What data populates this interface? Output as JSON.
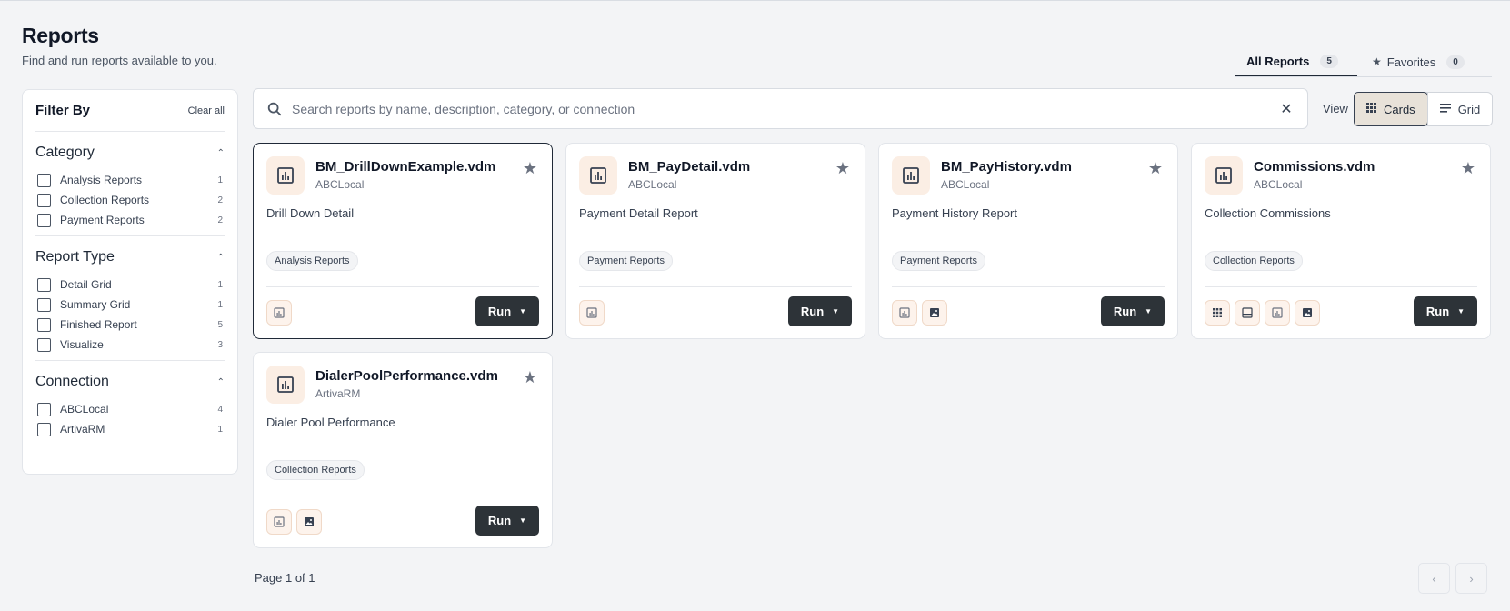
{
  "header": {
    "title": "Reports",
    "subtitle": "Find and run reports available to you."
  },
  "tabs": [
    {
      "label": "All Reports",
      "count": "5",
      "active": true
    },
    {
      "label": "Favorites",
      "count": "0",
      "active": false
    }
  ],
  "sidebar": {
    "title": "Filter By",
    "clear_all": "Clear all",
    "sections": [
      {
        "title": "Category",
        "options": [
          {
            "label": "Analysis Reports",
            "count": "1"
          },
          {
            "label": "Collection Reports",
            "count": "2"
          },
          {
            "label": "Payment Reports",
            "count": "2"
          }
        ]
      },
      {
        "title": "Report Type",
        "options": [
          {
            "label": "Detail Grid",
            "count": "1"
          },
          {
            "label": "Summary Grid",
            "count": "1"
          },
          {
            "label": "Finished Report",
            "count": "5"
          },
          {
            "label": "Visualize",
            "count": "3"
          }
        ]
      },
      {
        "title": "Connection",
        "options": [
          {
            "label": "ABCLocal",
            "count": "4"
          },
          {
            "label": "ArtivaRM",
            "count": "1"
          }
        ]
      }
    ]
  },
  "search": {
    "placeholder": "Search reports by name, description, category, or connection",
    "value": ""
  },
  "view": {
    "label": "View",
    "options": [
      "Cards",
      "Grid"
    ],
    "selected": "Cards"
  },
  "cards": [
    {
      "title": "BM_DrillDownExample.vdm",
      "connection": "ABCLocal",
      "description": "Drill Down Detail",
      "category": "Analysis Reports",
      "outputs": [
        "finished-report-icon"
      ],
      "run_label": "Run"
    },
    {
      "title": "BM_PayDetail.vdm",
      "connection": "ABCLocal",
      "description": "Payment Detail Report",
      "category": "Payment Reports",
      "outputs": [
        "finished-report-icon"
      ],
      "run_label": "Run"
    },
    {
      "title": "BM_PayHistory.vdm",
      "connection": "ABCLocal",
      "description": "Payment History Report",
      "category": "Payment Reports",
      "outputs": [
        "finished-report-icon",
        "visualize-icon"
      ],
      "run_label": "Run"
    },
    {
      "title": "Commissions.vdm",
      "connection": "ABCLocal",
      "description": "Collection Commissions",
      "category": "Collection Reports",
      "outputs": [
        "detail-grid-icon",
        "summary-grid-icon",
        "finished-report-icon",
        "visualize-icon"
      ],
      "run_label": "Run"
    },
    {
      "title": "DialerPoolPerformance.vdm",
      "connection": "ArtivaRM",
      "description": "Dialer Pool Performance",
      "category": "Collection Reports",
      "outputs": [
        "finished-report-icon",
        "visualize-icon"
      ],
      "run_label": "Run"
    }
  ],
  "pagination": {
    "text": "Page 1 of 1",
    "prev": "‹",
    "next": "›"
  }
}
